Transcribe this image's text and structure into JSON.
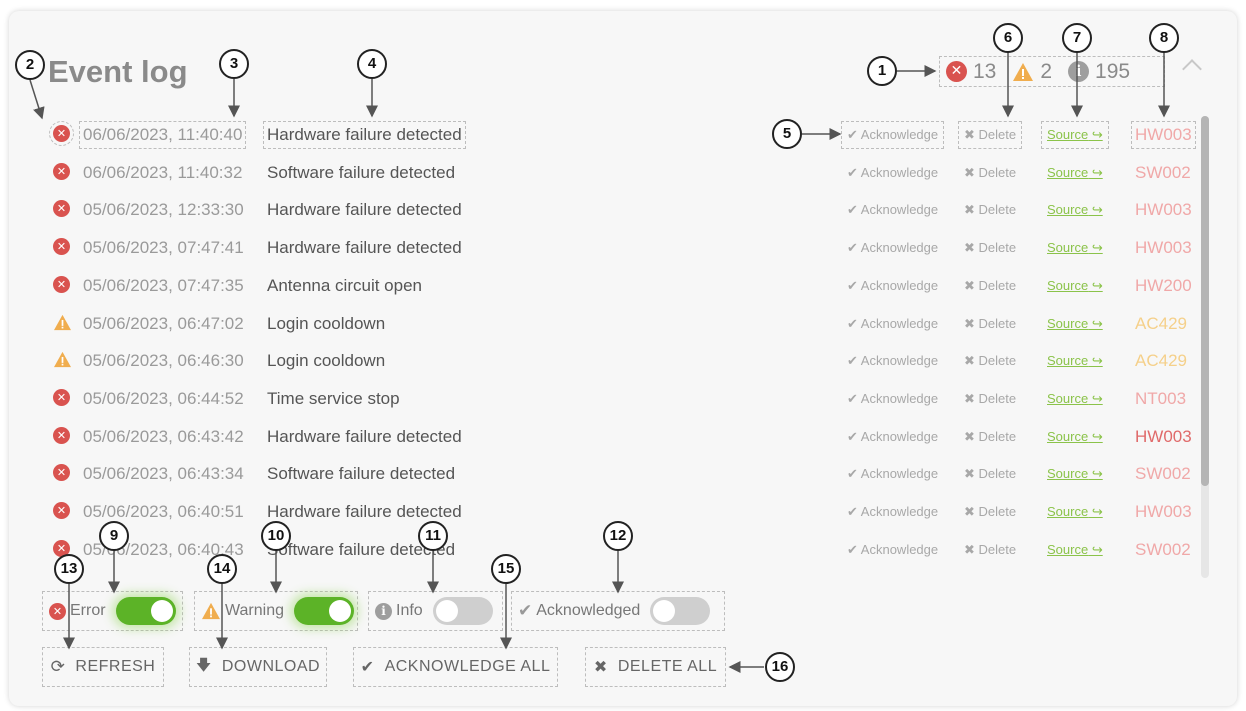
{
  "title": "Event log",
  "counts": {
    "error": "13",
    "warning": "2",
    "info": "195"
  },
  "actions": {
    "acknowledge": "Acknowledge",
    "delete": "Delete",
    "source": "Source"
  },
  "events": [
    {
      "type": "error",
      "timestamp": "06/06/2023, 11:40:40",
      "message": "Hardware failure detected",
      "code": "HW003",
      "code_color": "#f0a8a8"
    },
    {
      "type": "error",
      "timestamp": "06/06/2023, 11:40:32",
      "message": "Software failure detected",
      "code": "SW002",
      "code_color": "#f0a8a8"
    },
    {
      "type": "error",
      "timestamp": "05/06/2023, 12:33:30",
      "message": "Hardware failure detected",
      "code": "HW003",
      "code_color": "#f0a8a8"
    },
    {
      "type": "error",
      "timestamp": "05/06/2023, 07:47:41",
      "message": "Hardware failure detected",
      "code": "HW003",
      "code_color": "#f0a8a8"
    },
    {
      "type": "error",
      "timestamp": "05/06/2023, 07:47:35",
      "message": "Antenna circuit open",
      "code": "HW200",
      "code_color": "#f0a8a8"
    },
    {
      "type": "warning",
      "timestamp": "05/06/2023, 06:47:02",
      "message": "Login cooldown",
      "code": "AC429",
      "code_color": "#f5d08a"
    },
    {
      "type": "warning",
      "timestamp": "05/06/2023, 06:46:30",
      "message": "Login cooldown",
      "code": "AC429",
      "code_color": "#f5d08a"
    },
    {
      "type": "error",
      "timestamp": "05/06/2023, 06:44:52",
      "message": "Time service stop",
      "code": "NT003",
      "code_color": "#f0a8a8"
    },
    {
      "type": "error",
      "timestamp": "05/06/2023, 06:43:42",
      "message": "Hardware failure detected",
      "code": "HW003",
      "code_color": "#e06a6a"
    },
    {
      "type": "error",
      "timestamp": "05/06/2023, 06:43:34",
      "message": "Software failure detected",
      "code": "SW002",
      "code_color": "#f0a8a8"
    },
    {
      "type": "error",
      "timestamp": "05/06/2023, 06:40:51",
      "message": "Hardware failure detected",
      "code": "HW003",
      "code_color": "#f0a8a8"
    },
    {
      "type": "error",
      "timestamp": "05/06/2023, 06:40:43",
      "message": "Software failure detected",
      "code": "SW002",
      "code_color": "#f0a8a8"
    }
  ],
  "filters": {
    "error": {
      "label": "Error",
      "on": true
    },
    "warning": {
      "label": "Warning",
      "on": true
    },
    "info": {
      "label": "Info",
      "on": false
    },
    "acknowledged": {
      "label": "Acknowledged",
      "on": false
    }
  },
  "buttons": {
    "refresh": "REFRESH",
    "download": "DOWNLOAD",
    "acknowledge_all": "ACKNOWLEDGE ALL",
    "delete_all": "DELETE ALL"
  },
  "callouts": [
    "1",
    "2",
    "3",
    "4",
    "5",
    "6",
    "7",
    "8",
    "9",
    "10",
    "11",
    "12",
    "13",
    "14",
    "15",
    "16"
  ],
  "colors": {
    "error": "#d9534f",
    "warning": "#f0ad4e",
    "info": "#9e9e9e",
    "toggle_on": "#5cb327",
    "source_link": "#8bc34a"
  }
}
